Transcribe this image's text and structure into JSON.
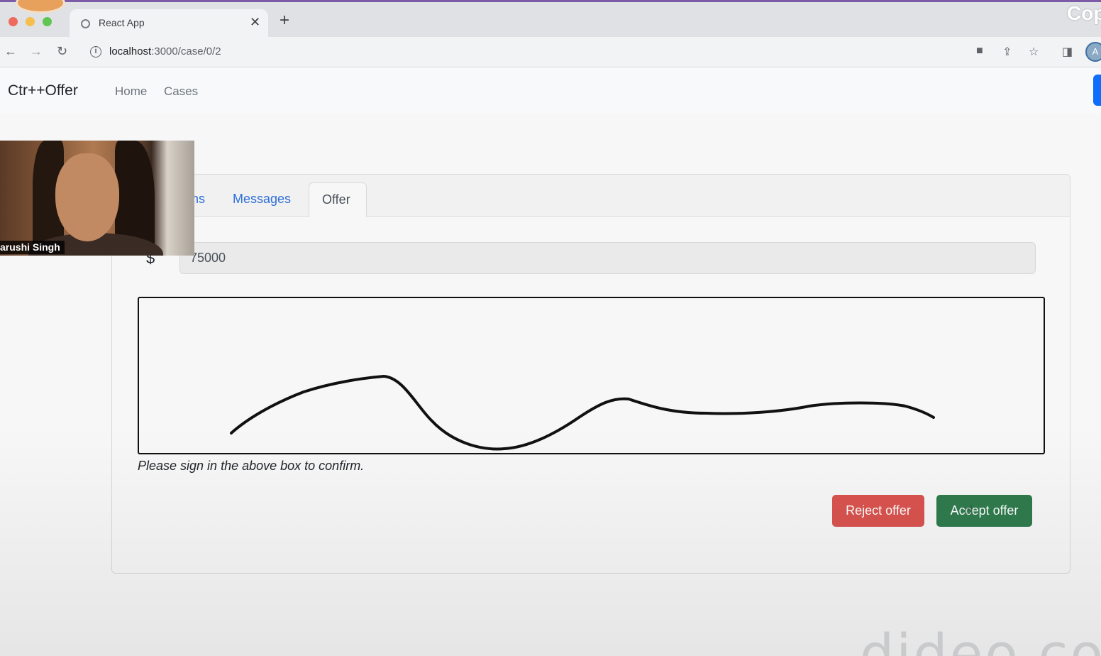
{
  "browser": {
    "tab_title": "React App",
    "tab_close": "✕",
    "new_tab": "+",
    "url_host": "localhost",
    "url_path": ":3000/case/0/2",
    "corner_text": "Cop",
    "profile_initial": "A"
  },
  "navbar": {
    "brand": "Ctr++Offer",
    "links": [
      "Home",
      "Cases"
    ]
  },
  "card": {
    "tabs": [
      "ns",
      "Messages",
      "Offer"
    ],
    "active_tab": "Offer",
    "currency_symbol": "$",
    "amount_value": "75000",
    "signature_caption": "Please sign in the above box to confirm.",
    "reject_label": "Reject offer",
    "accept_label": "Accept offer"
  },
  "webcam": {
    "name": "arushi Singh"
  },
  "watermark": "dideo.co"
}
